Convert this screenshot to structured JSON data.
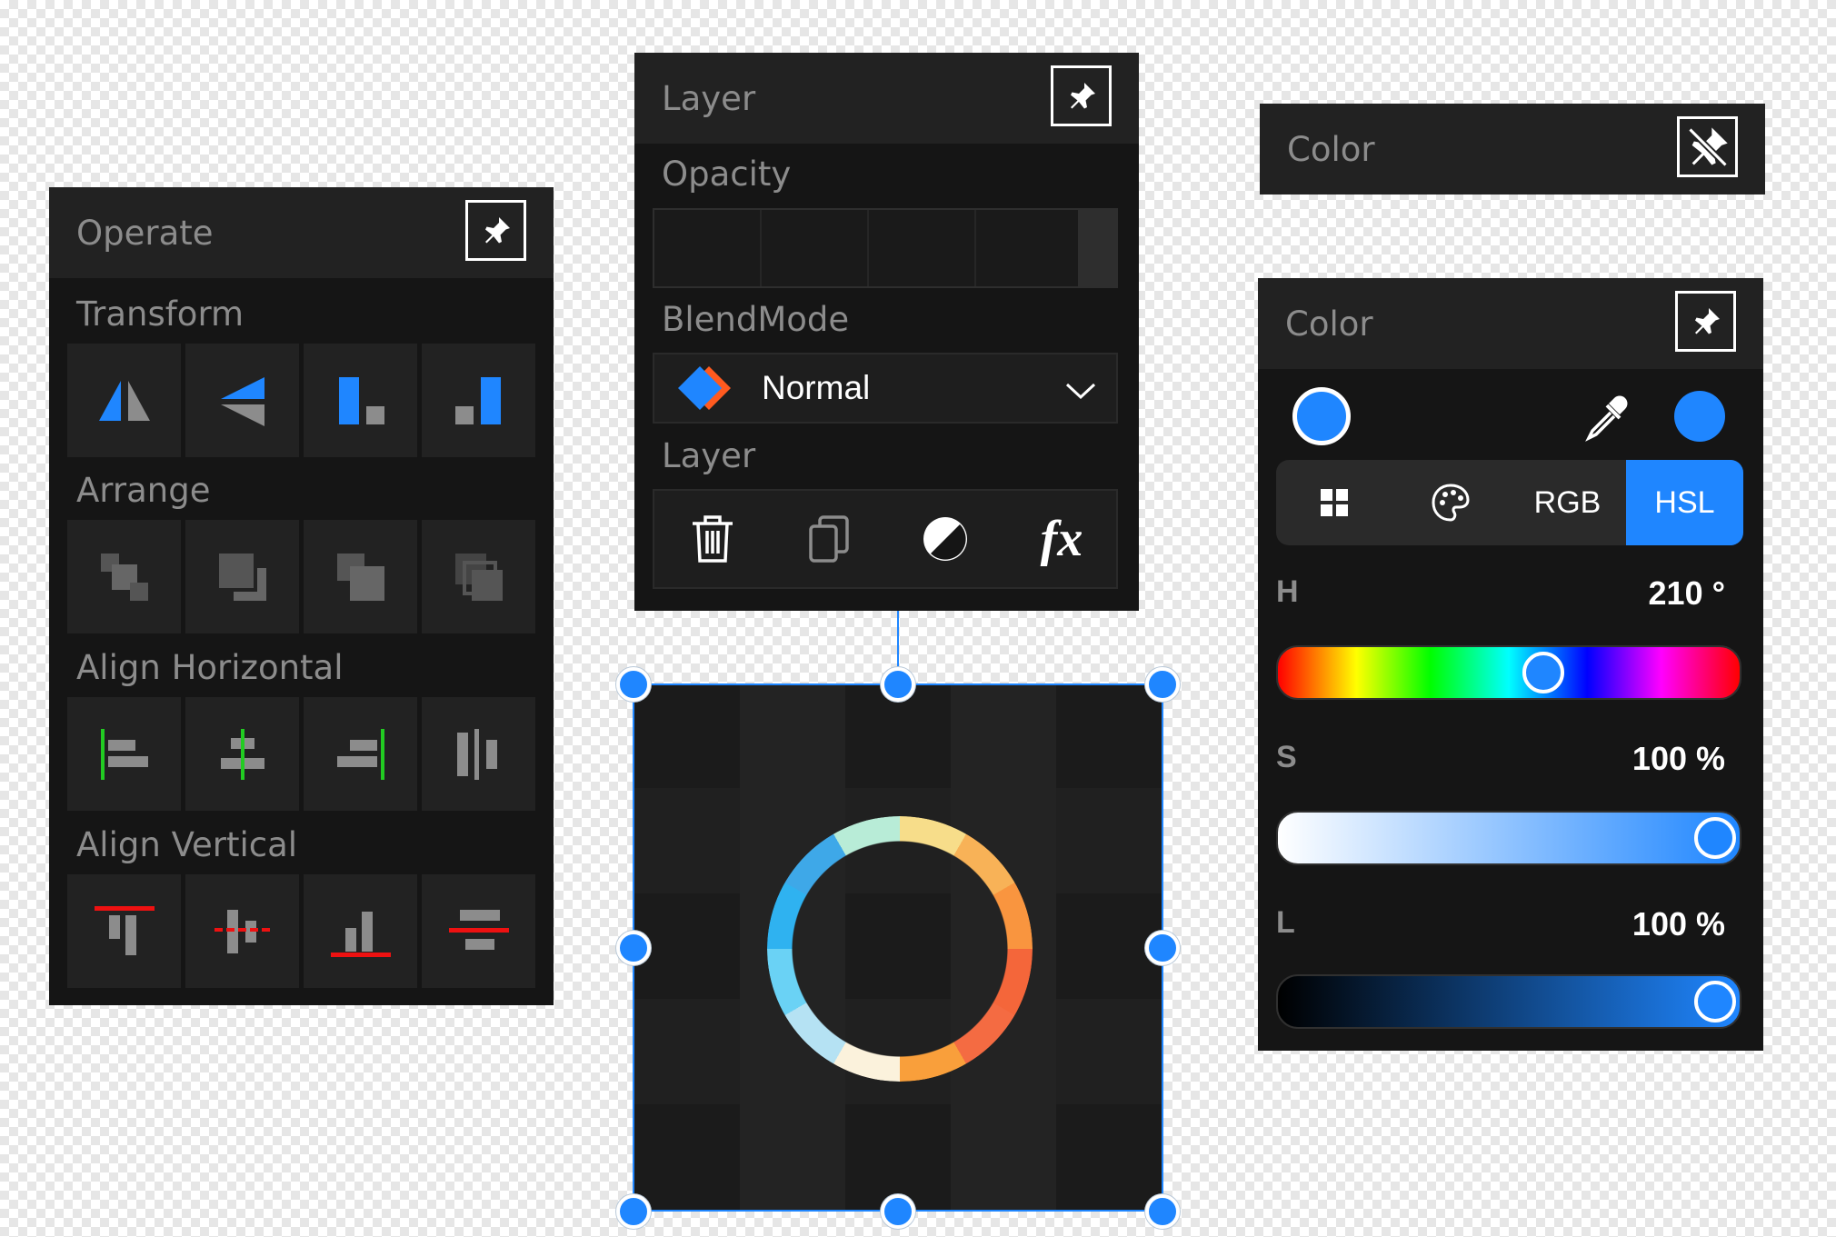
{
  "operate": {
    "title": "Operate",
    "sections": {
      "transform": "Transform",
      "arrange": "Arrange",
      "align_horizontal": "Align Horizontal",
      "align_vertical": "Align Vertical"
    },
    "icons": {
      "transform": [
        "flip-horizontal-icon",
        "flip-vertical-icon",
        "align-bottom-left-icon",
        "align-bottom-right-icon"
      ],
      "arrange": [
        "bring-to-front-icon",
        "send-to-back-icon",
        "bring-forward-icon",
        "send-backward-icon"
      ],
      "align_horizontal": [
        "align-left-icon",
        "align-center-icon",
        "align-right-icon",
        "distribute-horizontal-icon"
      ],
      "align_vertical": [
        "align-top-icon",
        "align-middle-icon",
        "align-bottom-icon",
        "distribute-vertical-icon"
      ]
    }
  },
  "layer": {
    "title": "Layer",
    "opacity_label": "Opacity",
    "opacity_value": 1.0,
    "blendmode_label": "BlendMode",
    "blendmode_value": "Normal",
    "layer_label": "Layer",
    "actions": [
      "delete-icon",
      "duplicate-icon",
      "adjustment-icon",
      "fx-icon"
    ],
    "fx_text": "fx"
  },
  "color_collapsed": {
    "title": "Color"
  },
  "color": {
    "title": "Color",
    "current_color": "#1f86ff",
    "tabs": [
      "swatches-icon",
      "palette-icon",
      "RGB",
      "HSL"
    ],
    "active_tab": "HSL",
    "h": {
      "label": "H",
      "value": "210 °",
      "fraction": 0.583
    },
    "s": {
      "label": "S",
      "value": "100 %",
      "fraction": 1.0
    },
    "l": {
      "label": "L",
      "value": "100 %",
      "fraction": 1.0
    }
  },
  "colors": {
    "accent": "#1f86ff",
    "green": "#22cc22",
    "red": "#ee1111",
    "panel": "#151515",
    "header": "#222222"
  }
}
